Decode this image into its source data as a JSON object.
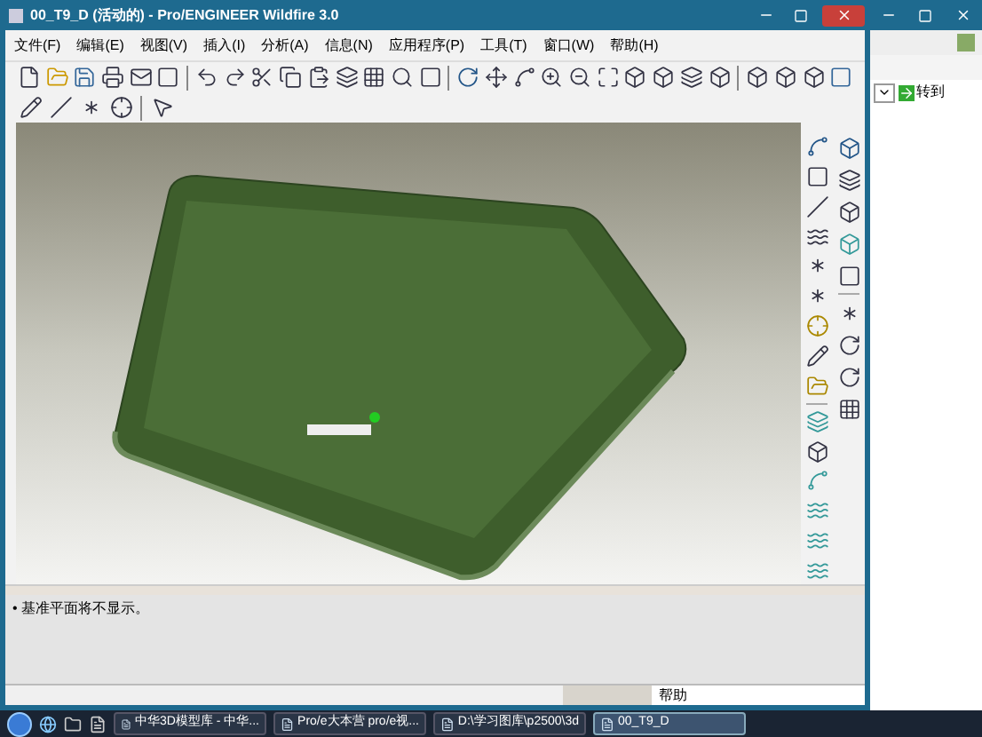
{
  "window": {
    "title": "00_T9_D (活动的) - Pro/ENGINEER Wildfire 3.0"
  },
  "menu": [
    "文件(F)",
    "编辑(E)",
    "视图(V)",
    "插入(I)",
    "分析(A)",
    "信息(N)",
    "应用程序(P)",
    "工具(T)",
    "窗口(W)",
    "帮助(H)"
  ],
  "background_window": {
    "go_button": "转到"
  },
  "message_area": {
    "messages": [
      "• 基准平面将不显示。"
    ]
  },
  "status_bar": {
    "help": "帮助"
  },
  "taskbar": {
    "items": [
      {
        "label": "中华3D模型库 - 中华...",
        "selected": false
      },
      {
        "label": "Pro/e大本营 pro/e视...",
        "selected": false
      },
      {
        "label": "D:\\学习图库\\p2500\\3d",
        "selected": false
      },
      {
        "label": "00_T9_D",
        "selected": true
      }
    ]
  }
}
